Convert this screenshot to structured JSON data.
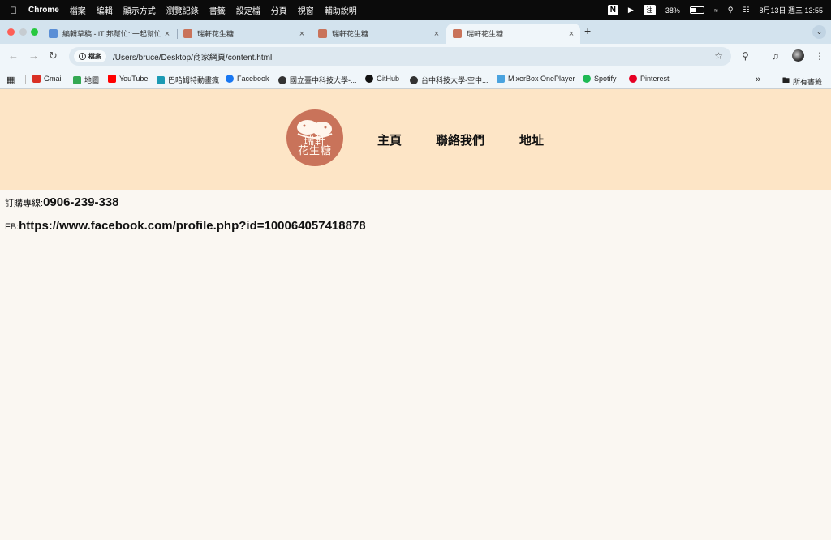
{
  "menubar": {
    "app_name": "Chrome",
    "items": [
      "檔案",
      "編輯",
      "顯示方式",
      "瀏覽記錄",
      "書籤",
      "設定檔",
      "分頁",
      "視窗",
      "輔助說明"
    ],
    "ime": "注",
    "battery": "38%",
    "battery_level": 0.38,
    "datetime": "8月13日 週三  13:55"
  },
  "tabs": [
    {
      "title": "編輯草稿 - iT 邦幫忙::一起幫忙",
      "favicon_color": "#5b8fd6"
    },
    {
      "title": "瑞軒花生糖",
      "favicon_color": "#c9735a"
    },
    {
      "title": "瑞軒花生糖",
      "favicon_color": "#c9735a"
    },
    {
      "title": "瑞軒花生糖",
      "favicon_color": "#c9735a",
      "active": true
    }
  ],
  "omnibox": {
    "chip_label": "檔案",
    "url": "/Users/bruce/Desktop/商家網頁/content.html"
  },
  "bookmarks": [
    {
      "label": "Gmail",
      "icon": "gmail-icon",
      "color": "#d93025"
    },
    {
      "label": "地圖",
      "icon": "maps-icon",
      "color": "#34a853"
    },
    {
      "label": "YouTube",
      "icon": "youtube-icon",
      "color": "#ff0000"
    },
    {
      "label": "巴哈姆特動畫瘋",
      "icon": "ani-icon",
      "color": "#1b9ab4"
    },
    {
      "label": "Facebook",
      "icon": "facebook-icon",
      "color": "#1877f2"
    },
    {
      "label": "國立臺中科技大學-...",
      "icon": "globe-icon",
      "color": "#333333"
    },
    {
      "label": "GitHub",
      "icon": "github-icon",
      "color": "#111111"
    },
    {
      "label": "台中科技大學-空中...",
      "icon": "globe-icon",
      "color": "#333333"
    },
    {
      "label": "MixerBox OnePlayer",
      "icon": "mixerbox-icon",
      "color": "#4aa3df"
    },
    {
      "label": "Spotify",
      "icon": "spotify-icon",
      "color": "#1db954"
    },
    {
      "label": "Pinterest",
      "icon": "pinterest-icon",
      "color": "#e60023"
    }
  ],
  "all_bookmarks": "所有書籤",
  "site": {
    "logo_text": "瑞軒\n花生糖",
    "nav": [
      "主頁",
      "聯絡我們",
      "地址"
    ],
    "phone_label": "訂購專線:",
    "phone_value": "0906-239-338",
    "fb_label": "FB:",
    "fb_value": "https://www.facebook.com/profile.php?id=100064057418878"
  },
  "colors": {
    "header_bg": "#fde5c6",
    "page_bg": "#faf7f2",
    "logo_bg": "#c9735a"
  }
}
